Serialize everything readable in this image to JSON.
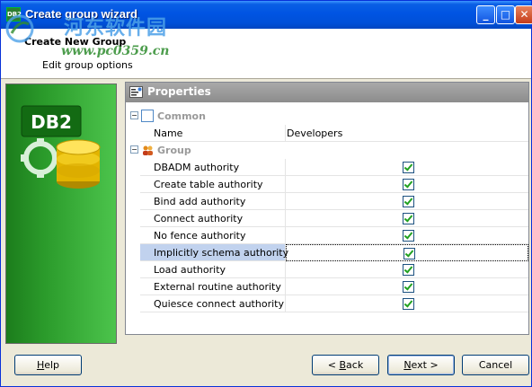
{
  "window": {
    "title": "Create group wizard",
    "title_icon_text": "DB2"
  },
  "watermark": {
    "title": "河东软件园",
    "url": "www.pc0359.cn"
  },
  "header": {
    "title": "Create New Group",
    "subtitle": "Edit group options"
  },
  "side_panel": {
    "logo_text": "DB2"
  },
  "properties": {
    "title": "Properties",
    "categories": [
      {
        "label": "Common",
        "expander": "−"
      },
      {
        "label": "Group",
        "expander": "−"
      }
    ],
    "name_row": {
      "label": "Name",
      "value": "Developers"
    },
    "authorities": [
      {
        "label": "DBADM authority",
        "checked": true
      },
      {
        "label": "Create table authority",
        "checked": true
      },
      {
        "label": "Bind add authority",
        "checked": true
      },
      {
        "label": "Connect authority",
        "checked": true
      },
      {
        "label": "No fence authority",
        "checked": true
      },
      {
        "label": "Implicitly schema authority",
        "checked": true,
        "selected": true
      },
      {
        "label": "Load authority",
        "checked": true
      },
      {
        "label": "External routine authority",
        "checked": true
      },
      {
        "label": "Quiesce connect authority",
        "checked": true
      }
    ]
  },
  "buttons": {
    "help": {
      "label": "Help",
      "mnemonic": "H",
      "rest": "elp"
    },
    "back": {
      "label": "< Back",
      "prefix": "< ",
      "mnemonic": "B",
      "rest": "ack"
    },
    "next": {
      "label": "Next >",
      "mnemonic": "N",
      "rest": "ext >"
    },
    "cancel": {
      "label": "Cancel"
    }
  },
  "colors": {
    "titlebar": "#0054e3",
    "side_panel": "#2b9b2b",
    "selected_row": "#c1d2ee"
  }
}
